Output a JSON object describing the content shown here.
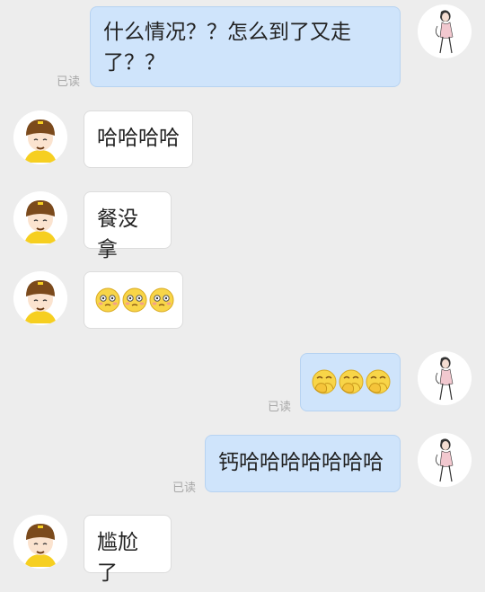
{
  "read_label": "已读",
  "messages": [
    {
      "side": "out",
      "text": "什么情况？？怎么到了又走了？？",
      "line1": "什么情况？？怎么到了又走",
      "line2": "了？？"
    },
    {
      "side": "in",
      "text": "哈哈哈哈"
    },
    {
      "side": "in",
      "text": "餐没拿"
    },
    {
      "side": "in",
      "emoji": [
        "flushed-face",
        "flushed-face",
        "flushed-face"
      ]
    },
    {
      "side": "out",
      "emoji": [
        "hand-over-mouth-laugh",
        "hand-over-mouth-laugh",
        "hand-over-mouth-laugh"
      ]
    },
    {
      "side": "out",
      "text": "钙哈哈哈哈哈哈哈"
    },
    {
      "side": "in",
      "text": "尴尬了"
    }
  ],
  "avatars": {
    "incoming": "courier-helmet-avatar",
    "outgoing": "girl-sketch-avatar"
  },
  "colors": {
    "background": "#ededed",
    "incoming_bubble": "#ffffff",
    "outgoing_bubble": "#cfe4fb",
    "read_text": "#a8a8a8"
  }
}
